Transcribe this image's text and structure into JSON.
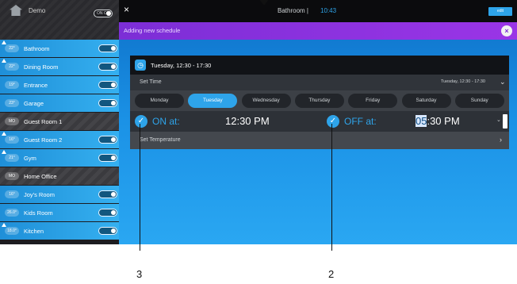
{
  "sidebar": {
    "demo": {
      "label": "Demo",
      "toggle_text": "ON OFF"
    },
    "rooms": [
      {
        "name": "Bathroom",
        "temp": "22°",
        "state": "active",
        "flame": true
      },
      {
        "name": "Dining Room",
        "temp": "22°",
        "state": "active",
        "flame": true
      },
      {
        "name": "Entrance",
        "temp": "19°",
        "state": "active",
        "flame": false
      },
      {
        "name": "Garage",
        "temp": "23°",
        "state": "active",
        "flame": false
      },
      {
        "name": "Guest Room 1",
        "temp": "MO",
        "state": "inactive",
        "flame": false
      },
      {
        "name": "Guest Room 2",
        "temp": "16°",
        "state": "active",
        "flame": true
      },
      {
        "name": "Gym",
        "temp": "21°",
        "state": "active",
        "flame": true
      },
      {
        "name": "Home Office",
        "temp": "MO",
        "state": "inactive",
        "flame": false
      },
      {
        "name": "Joy's Room",
        "temp": "16°",
        "state": "active",
        "flame": false
      },
      {
        "name": "Kids Room",
        "temp": "26.0°",
        "state": "active",
        "flame": false
      },
      {
        "name": "Kitchen",
        "temp": "18.0°",
        "state": "active",
        "flame": true
      }
    ]
  },
  "topbar": {
    "close_glyph": "×",
    "title": "Bathroom | ",
    "time": "10:43",
    "badge": "edit"
  },
  "notice": {
    "text": "Adding new schedule",
    "close_glyph": "×"
  },
  "schedule": {
    "header_title": "Tuesday, 12:30 - 17:30",
    "clock_glyph": "◷",
    "set_time_label": "Set Time",
    "set_time_value": "Tuesday, 12:30 - 17:30",
    "chevron_down": "⌄",
    "days": [
      "Monday",
      "Tuesday",
      "Wednesday",
      "Thursday",
      "Friday",
      "Saturday",
      "Sunday"
    ],
    "selected_day": "Tuesday",
    "on_label": "ON at:",
    "on_time": "12:30 PM",
    "off_label": "OFF at:",
    "off_time_hour": "05",
    "off_time_rest": ":30 PM",
    "check_glyph": "✓",
    "set_temperature_label": "Set Temperature",
    "chevron_right": "›"
  },
  "callouts": [
    "3",
    "2"
  ],
  "colors": {
    "accent": "#2ea4ea",
    "purple": "#8a32de",
    "dark": "#0b0b0d"
  }
}
